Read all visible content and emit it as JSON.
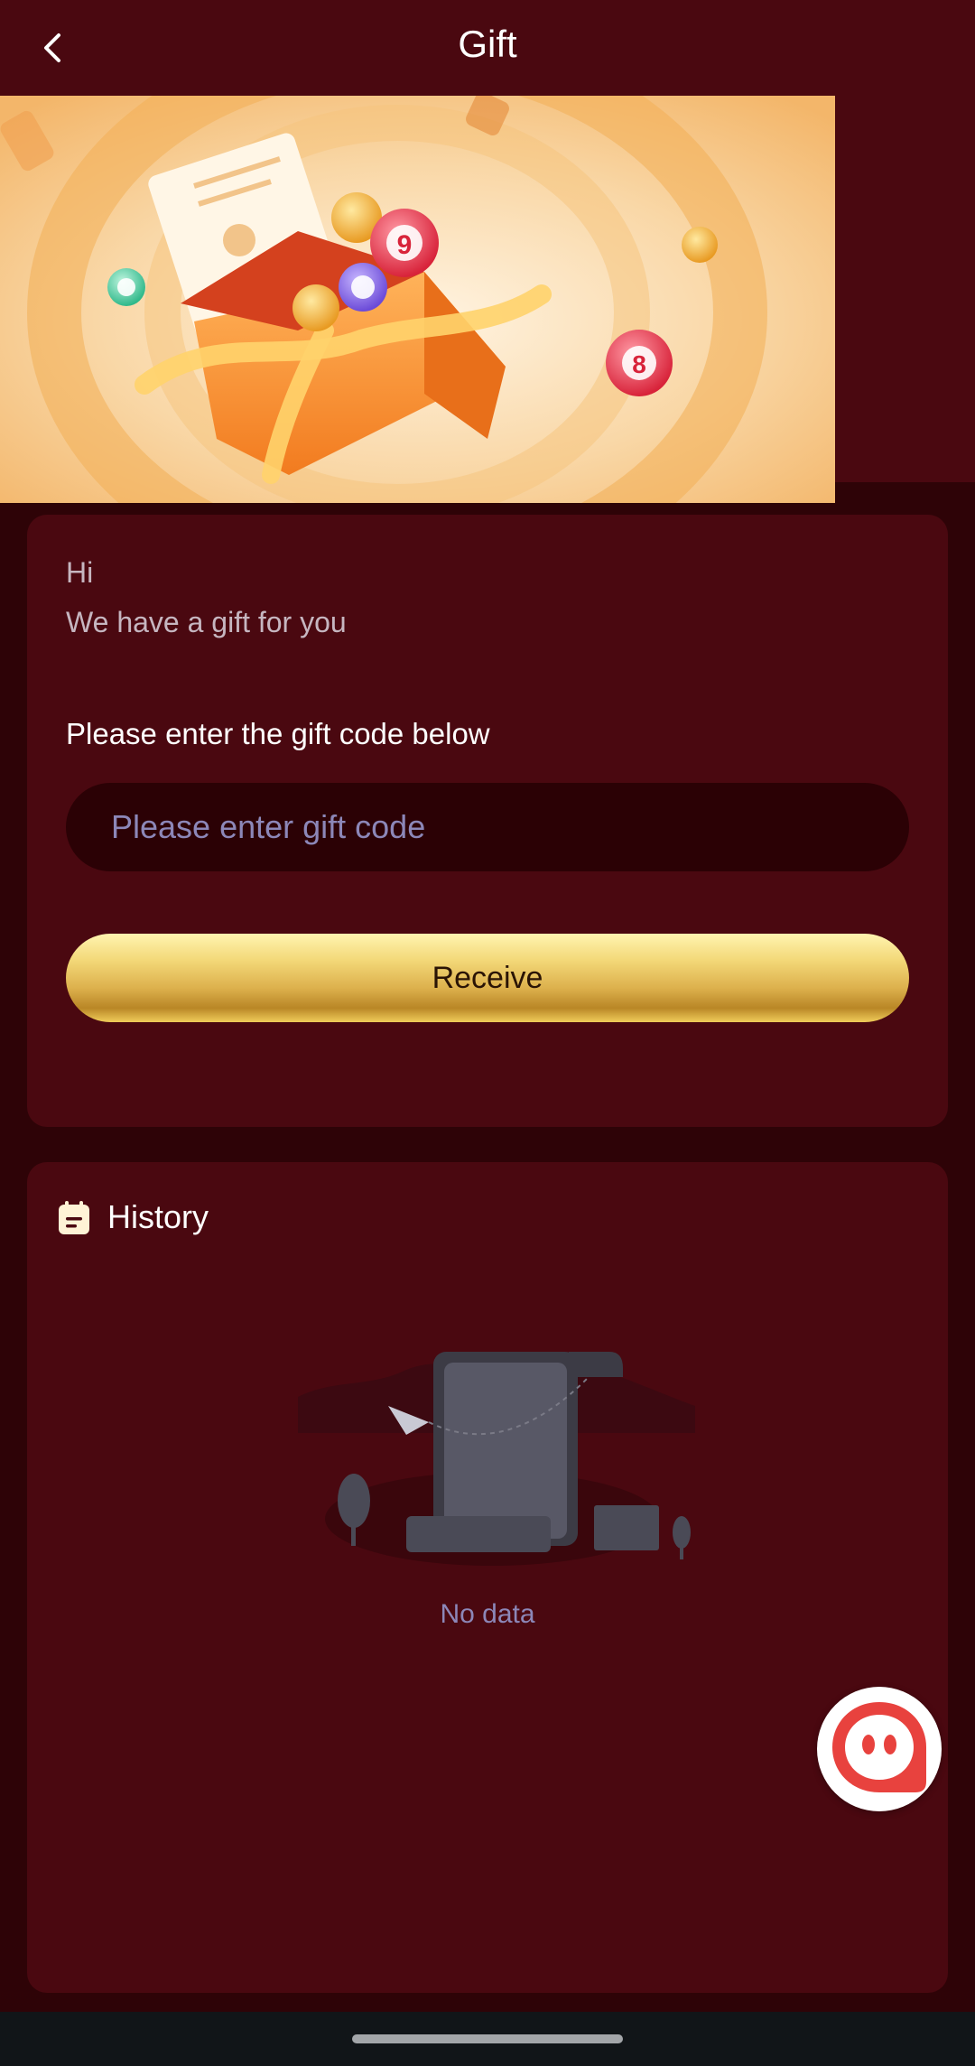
{
  "header": {
    "title": "Gift",
    "back_icon": "chevron-left-icon"
  },
  "banner": {
    "description_icon": "gift-box-banner"
  },
  "gift_card": {
    "greeting": "Hi",
    "subtitle": "We have a gift for you",
    "prompt": "Please enter the gift code below",
    "input": {
      "placeholder": "Please enter gift code",
      "value": ""
    },
    "receive_label": "Receive"
  },
  "history": {
    "title": "History",
    "icon": "calendar-icon",
    "empty_text": "No data"
  },
  "fab": {
    "icon": "chat-support-icon"
  },
  "colors": {
    "page_bg": "#2e0307",
    "card_bg": "#4a0810",
    "input_bg": "#2b0105",
    "placeholder": "#8c87b8",
    "button_gold": "#dcb04c"
  }
}
